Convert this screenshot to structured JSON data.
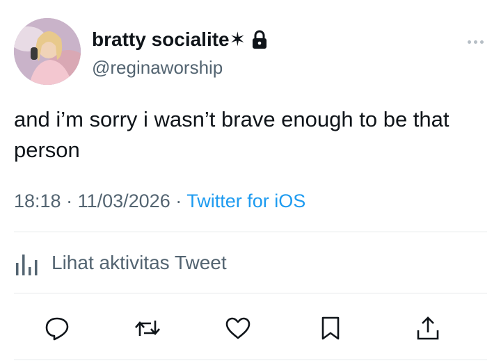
{
  "author": {
    "display_name": "bratty socialite✶",
    "handle": "@reginaworship",
    "protected_icon": "lock-icon",
    "avatar_icon": "profile-photo"
  },
  "tweet": {
    "text": "and i’m sorry i wasn’t brave enough to be that person",
    "time": "18:18",
    "date": "11/03/2026",
    "separator": " · ",
    "source": "Twitter for iOS"
  },
  "activity": {
    "label": "Lihat aktivitas Tweet",
    "icon": "analytics-icon"
  },
  "actions": [
    {
      "icon": "reply-icon"
    },
    {
      "icon": "retweet-icon"
    },
    {
      "icon": "like-icon"
    },
    {
      "icon": "bookmark-icon"
    },
    {
      "icon": "share-icon"
    }
  ],
  "colors": {
    "text": "#0f1419",
    "secondary": "#536471",
    "link": "#1d9bf0",
    "divider": "#e6e9eb"
  }
}
